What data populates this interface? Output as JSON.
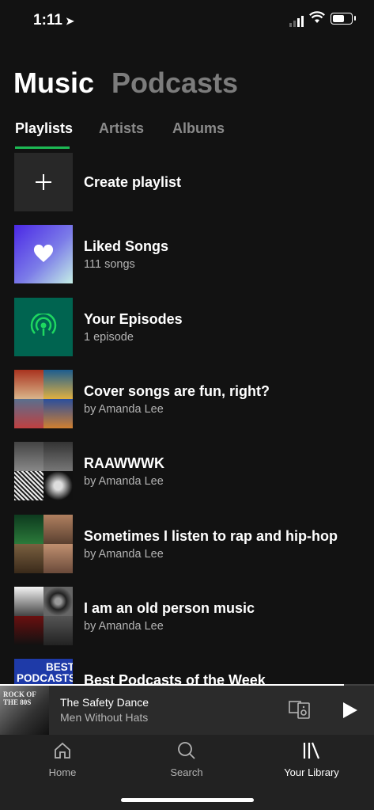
{
  "status_bar": {
    "time": "1:11",
    "location_icon": "location-arrow-icon"
  },
  "categories": {
    "music": "Music",
    "podcasts": "Podcasts",
    "active": "music"
  },
  "tabs": [
    "Playlists",
    "Artists",
    "Albums"
  ],
  "active_tab": "Playlists",
  "accent_color": "#1db954",
  "playlists": [
    {
      "title": "Create playlist",
      "subtitle": "",
      "icon": "plus-icon"
    },
    {
      "title": "Liked Songs",
      "subtitle": "111 songs",
      "icon": "heart-icon"
    },
    {
      "title": "Your Episodes",
      "subtitle": "1 episode",
      "icon": "podcast-signal-icon"
    },
    {
      "title": "Cover songs are fun, right?",
      "subtitle": "by Amanda Lee"
    },
    {
      "title": "RAAWWWK",
      "subtitle": "by Amanda Lee"
    },
    {
      "title": "Sometimes I listen to rap and hip-hop",
      "subtitle": "by Amanda Lee"
    },
    {
      "title": "I am an old person music",
      "subtitle": "by Amanda Lee"
    },
    {
      "title": "Best Podcasts of the Week",
      "subtitle": "",
      "cover_text": [
        "BEST",
        "PODCASTS"
      ]
    }
  ],
  "now_playing": {
    "title": "The Safety Dance",
    "artist": "Men Without Hats",
    "album_art_text": "ROCK OF THE 80S",
    "progress": 0.92
  },
  "bottom_nav": [
    {
      "label": "Home",
      "icon": "home-icon"
    },
    {
      "label": "Search",
      "icon": "search-icon"
    },
    {
      "label": "Your Library",
      "icon": "library-icon"
    }
  ],
  "active_nav": "Your Library"
}
